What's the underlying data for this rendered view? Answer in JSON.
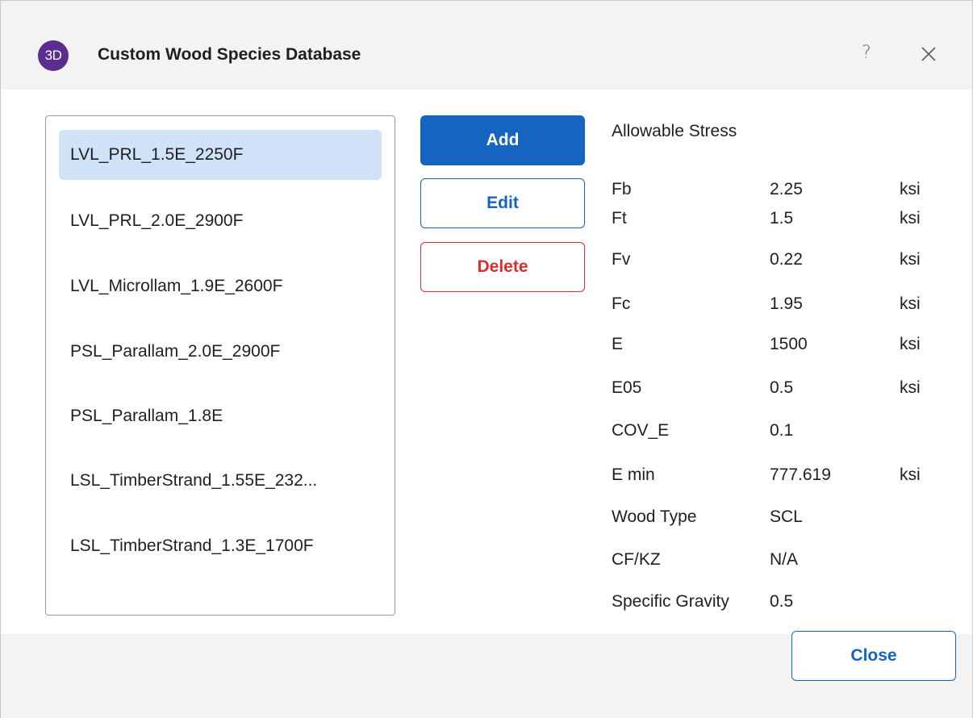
{
  "window": {
    "logo_text": "3D",
    "title": "Custom Wood Species Database",
    "help_label": "?",
    "accent_color": "#1565c0",
    "danger_color": "#d32f2f",
    "logo_color": "#5b2d8e"
  },
  "species_list": {
    "items": [
      {
        "label": "LVL_PRL_1.5E_2250F",
        "selected": true
      },
      {
        "label": "LVL_PRL_2.0E_2900F",
        "selected": false
      },
      {
        "label": "LVL_Microllam_1.9E_2600F",
        "selected": false
      },
      {
        "label": "PSL_Parallam_2.0E_2900F",
        "selected": false
      },
      {
        "label": "PSL_Parallam_1.8E",
        "selected": false
      },
      {
        "label": "LSL_TimberStrand_1.55E_232...",
        "selected": false
      },
      {
        "label": "LSL_TimberStrand_1.3E_1700F",
        "selected": false
      }
    ]
  },
  "actions": {
    "add_label": "Add",
    "edit_label": "Edit",
    "delete_label": "Delete"
  },
  "properties": {
    "header": "Allowable Stress",
    "rows": [
      {
        "name": "Fb",
        "value": "2.25",
        "unit": "ksi"
      },
      {
        "name": "Ft",
        "value": "1.5",
        "unit": "ksi"
      },
      {
        "name": "Fv",
        "value": "0.22",
        "unit": "ksi"
      },
      {
        "name": "Fc",
        "value": "1.95",
        "unit": "ksi"
      },
      {
        "name": "E",
        "value": "1500",
        "unit": "ksi"
      },
      {
        "name": "E05",
        "value": "0.5",
        "unit": "ksi"
      },
      {
        "name": "COV_E",
        "value": "0.1",
        "unit": ""
      },
      {
        "name": "E min",
        "value": "777.619",
        "unit": "ksi"
      },
      {
        "name": "Wood Type",
        "value": "SCL",
        "unit": ""
      },
      {
        "name": "CF/KZ",
        "value": "N/A",
        "unit": ""
      },
      {
        "name": "Specific Gravity",
        "value": "0.5",
        "unit": ""
      }
    ]
  },
  "footer": {
    "close_label": "Close"
  }
}
